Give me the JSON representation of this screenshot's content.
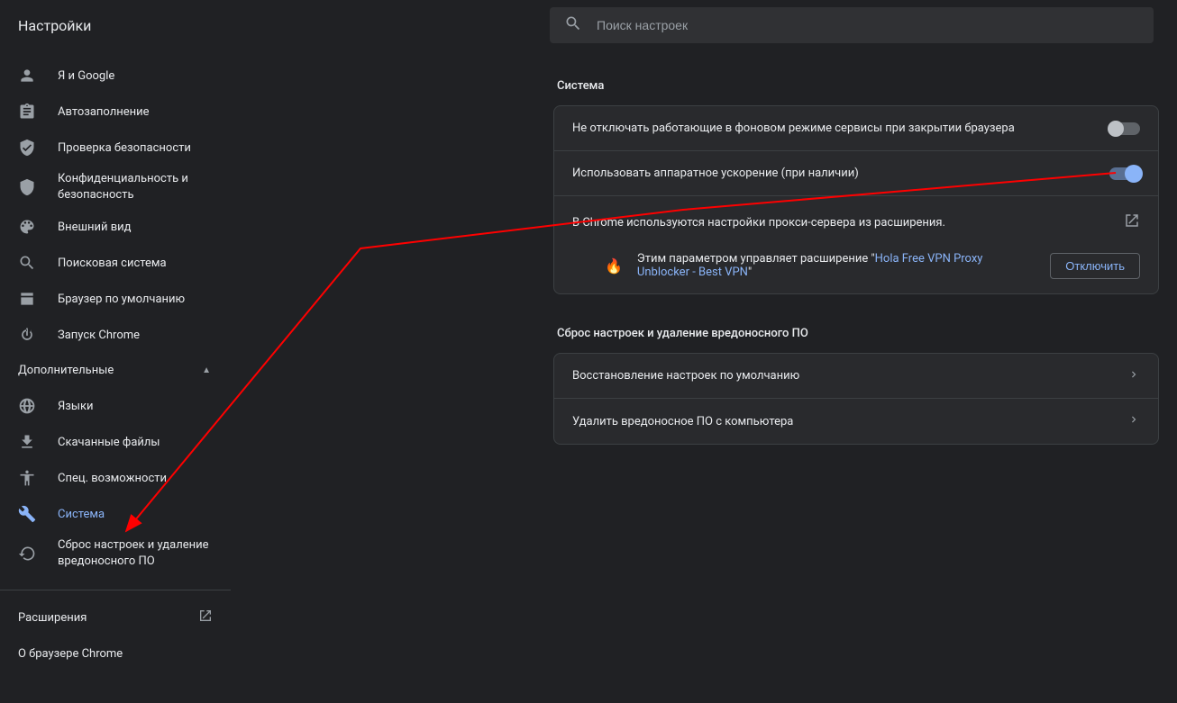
{
  "header": {
    "title": "Настройки",
    "search_placeholder": "Поиск настроек"
  },
  "sidebar": {
    "items": [
      {
        "id": "you-and-google",
        "label": "Я и Google"
      },
      {
        "id": "autofill",
        "label": "Автозаполнение"
      },
      {
        "id": "safety-check",
        "label": "Проверка безопасности"
      },
      {
        "id": "privacy",
        "label": "Конфиденциальность и безопасность"
      },
      {
        "id": "appearance",
        "label": "Внешний вид"
      },
      {
        "id": "search-engine",
        "label": "Поисковая система"
      },
      {
        "id": "default-browser",
        "label": "Браузер по умолчанию"
      },
      {
        "id": "on-startup",
        "label": "Запуск Chrome"
      }
    ],
    "advanced_label": "Дополнительные",
    "advanced_items": [
      {
        "id": "languages",
        "label": "Языки"
      },
      {
        "id": "downloads",
        "label": "Скачанные файлы"
      },
      {
        "id": "accessibility",
        "label": "Спец. возможности"
      },
      {
        "id": "system",
        "label": "Система",
        "active": true
      },
      {
        "id": "reset",
        "label": "Сброс настроек и удаление вредоносного ПО"
      }
    ],
    "footer": {
      "extensions_label": "Расширения",
      "about_label": "О браузере Chrome"
    }
  },
  "main": {
    "system": {
      "title": "Система",
      "rows": {
        "background": "Не отключать работающие в фоновом режиме сервисы при закрытии браузера",
        "hw_accel": "Использовать аппаратное ускорение (при наличии)",
        "proxy": "В Chrome используются настройки прокси-сервера из расширения.",
        "ext_notice_prefix": "Этим параметром управляет расширение \"",
        "ext_name": "Hola Free VPN Proxy Unblocker - Best VPN",
        "ext_notice_suffix": "\"",
        "disable_btn": "Отключить"
      }
    },
    "reset": {
      "title": "Сброс настроек и удаление вредоносного ПО",
      "rows": {
        "restore": "Восстановление настроек по умолчанию",
        "cleanup": "Удалить вредоносное ПО с компьютера"
      }
    }
  }
}
